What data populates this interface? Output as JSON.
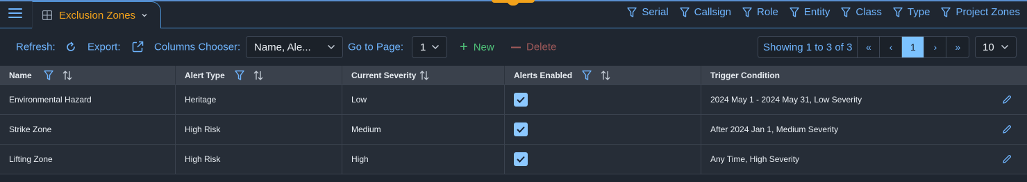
{
  "nav": {
    "tab_label": "Exclusion Zones",
    "filters": [
      "Serial",
      "Callsign",
      "Role",
      "Entity",
      "Class",
      "Type",
      "Project Zones"
    ]
  },
  "toolbar": {
    "refresh_label": "Refresh:",
    "export_label": "Export:",
    "columns_chooser_label": "Columns Chooser:",
    "columns_chooser_value": "Name, Ale...",
    "goto_page_label": "Go to Page:",
    "goto_page_value": "1",
    "new_label": "New",
    "delete_label": "Delete",
    "showing_text": "Showing 1 to 3 of 3",
    "current_page": "1",
    "page_size": "10"
  },
  "table": {
    "headers": [
      "Name",
      "Alert Type",
      "Current Severity",
      "Alerts Enabled",
      "Trigger Condition"
    ],
    "rows": [
      {
        "name": "Environmental Hazard",
        "alert_type": "Heritage",
        "severity": "Low",
        "alerts_enabled": true,
        "trigger": "2024 May 1 - 2024 May 31, Low Severity"
      },
      {
        "name": "Strike Zone",
        "alert_type": "High Risk",
        "severity": "Medium",
        "alerts_enabled": true,
        "trigger": "After 2024 Jan 1, Medium Severity"
      },
      {
        "name": "Lifting Zone",
        "alert_type": "High Risk",
        "severity": "High",
        "alerts_enabled": true,
        "trigger": "Any Time, High Severity"
      }
    ]
  },
  "colors": {
    "accent": "#6fb5ff",
    "tab_accent": "#f2a21b",
    "new": "#4fc279",
    "delete": "#a05a5a"
  },
  "icons": [
    "menu-icon",
    "table-icon",
    "chevron-down-icon",
    "filter-icon",
    "refresh-icon",
    "export-icon",
    "plus-icon",
    "minus-icon",
    "first-page-icon",
    "prev-page-icon",
    "next-page-icon",
    "last-page-icon",
    "sort-icon",
    "checkbox-checked-icon",
    "edit-pencil-icon"
  ]
}
